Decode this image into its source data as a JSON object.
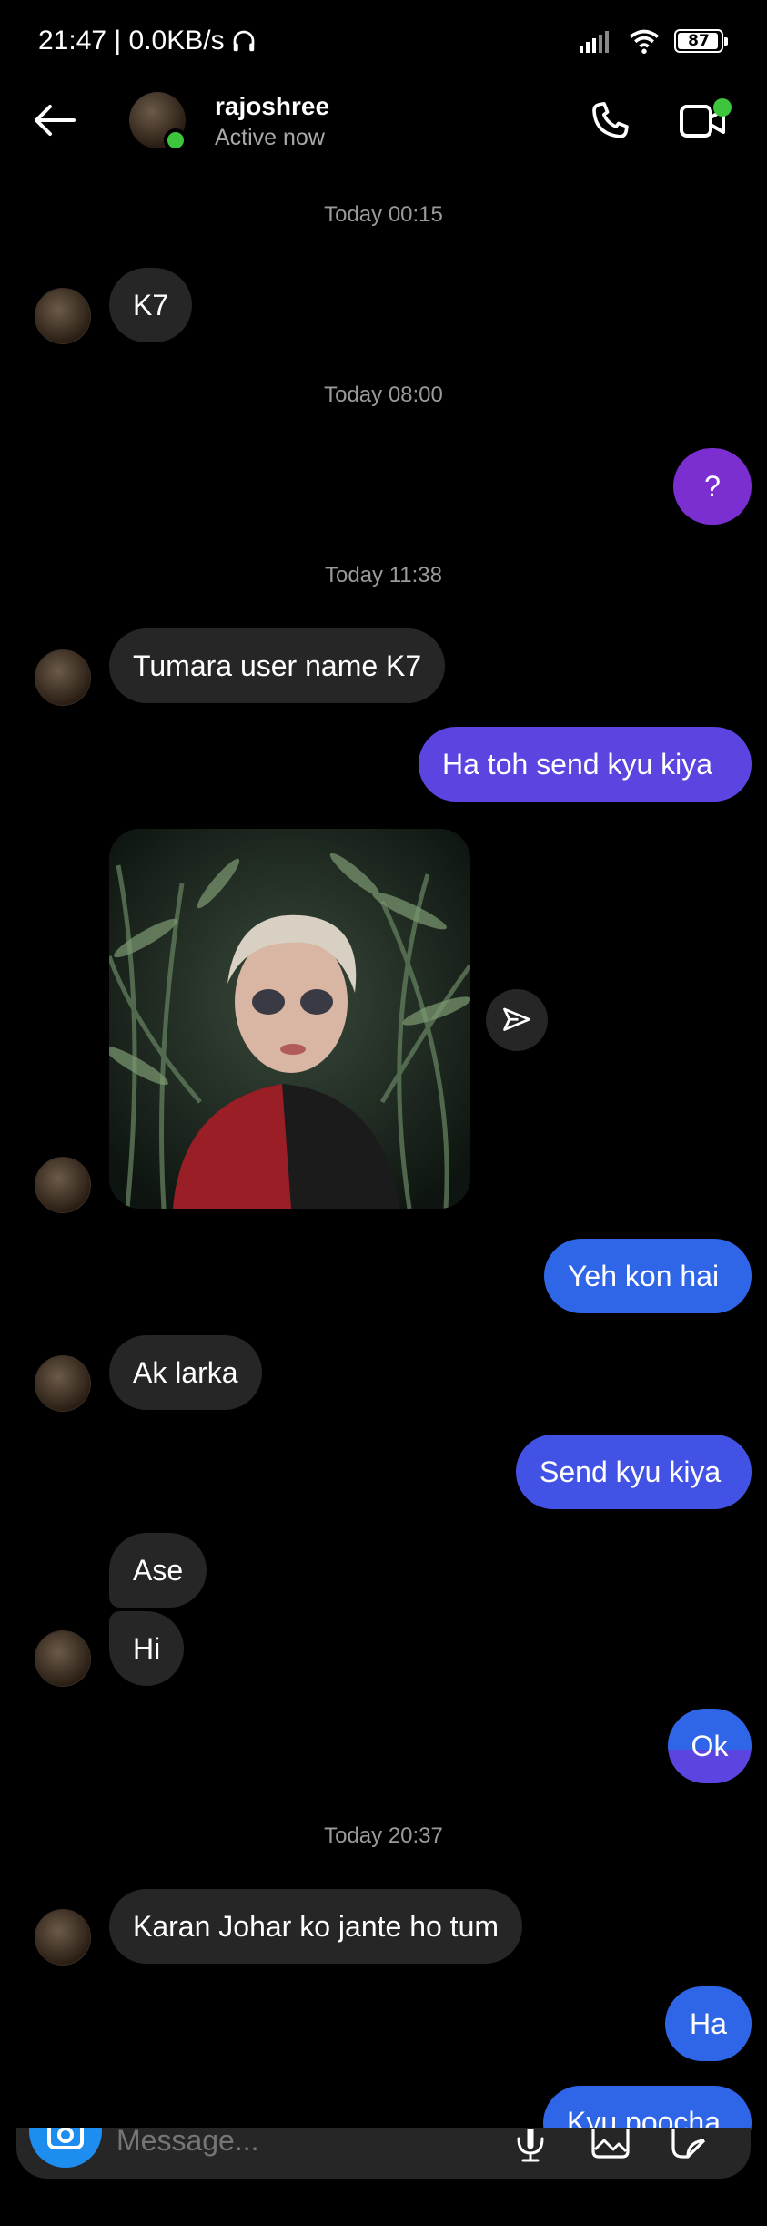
{
  "status_bar": {
    "time_speed": "21:47 | 0.0KB/s",
    "battery": "87"
  },
  "header": {
    "name": "rajoshree",
    "status": "Active now"
  },
  "messages": {
    "ts1": "Today 00:15",
    "m1": "K7",
    "ts2": "Today 08:00",
    "m2": "?",
    "ts3": "Today 11:38",
    "m3": "Tumara user name K7",
    "m4": "Ha toh send kyu kiya",
    "m5": "Yeh kon hai",
    "m6": "Ak larka",
    "m7": "Send kyu kiya",
    "m8": "Ase",
    "m9": "Hi",
    "m10": "Ok",
    "ts4": "Today 20:37",
    "m11": "Karan Johar ko jante ho tum",
    "m12": "Ha",
    "m13": "Kyu poocha"
  },
  "composer": {
    "placeholder": "Message..."
  },
  "colors": {
    "incoming_bubble": "#262626",
    "outgoing_purple": "#7b2fd0",
    "outgoing_violet": "#5b45e0",
    "outgoing_blue": "#2f66e8",
    "online": "#3ec53e"
  }
}
